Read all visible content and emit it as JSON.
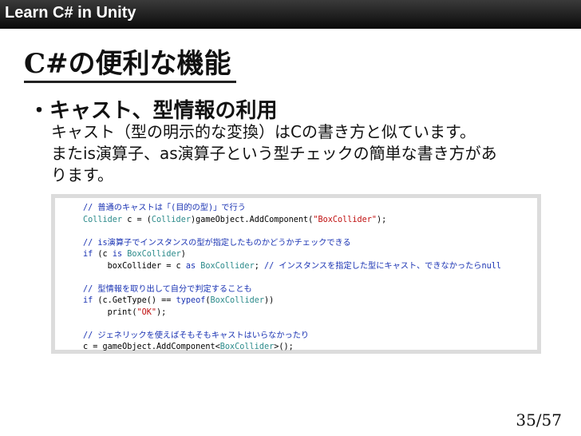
{
  "header": {
    "title": "Learn C# in Unity"
  },
  "slide": {
    "title": "C#の便利な機能",
    "bullet": "・キャスト、型情報の利用",
    "body_lines": [
      "キャスト（型の明示的な変換）はCの書き方と似ています。",
      "またis演算子、as演算子という型チェックの簡単な書き方があ",
      "ります。"
    ]
  },
  "code_lines": [
    [
      [
        "comment",
        "// 普通のキャストは「(目的の型)」で行う"
      ]
    ],
    [
      [
        "type",
        "Collider"
      ],
      [
        "plain",
        " c = ("
      ],
      [
        "type",
        "Collider"
      ],
      [
        "plain",
        ")gameObject.AddComponent("
      ],
      [
        "str",
        "\"BoxCollider\""
      ],
      [
        "plain",
        ");"
      ]
    ],
    [],
    [
      [
        "comment",
        "// is演算子でインスタンスの型が指定したものかどうかチェックできる"
      ]
    ],
    [
      [
        "kw",
        "if"
      ],
      [
        "plain",
        " (c "
      ],
      [
        "kw",
        "is"
      ],
      [
        "plain",
        " "
      ],
      [
        "type",
        "BoxCollider"
      ],
      [
        "plain",
        ")"
      ]
    ],
    [
      [
        "plain",
        "     boxCollider = c "
      ],
      [
        "kw",
        "as"
      ],
      [
        "plain",
        " "
      ],
      [
        "type",
        "BoxCollider"
      ],
      [
        "plain",
        "; "
      ],
      [
        "comment",
        "// インスタンスを指定した型にキャスト、できなかったらnull"
      ]
    ],
    [],
    [
      [
        "comment",
        "// 型情報を取り出して自分で判定することも"
      ]
    ],
    [
      [
        "kw",
        "if"
      ],
      [
        "plain",
        " (c.GetType() == "
      ],
      [
        "kw",
        "typeof"
      ],
      [
        "plain",
        "("
      ],
      [
        "type",
        "BoxCollider"
      ],
      [
        "plain",
        "))"
      ]
    ],
    [
      [
        "plain",
        "     print("
      ],
      [
        "str",
        "\"OK\""
      ],
      [
        "plain",
        ");"
      ]
    ],
    [],
    [
      [
        "comment",
        "// ジェネリックを使えばそもそもキャストはいらなかったり"
      ]
    ],
    [
      [
        "plain",
        "c = gameObject.AddComponent<"
      ],
      [
        "type",
        "BoxCollider"
      ],
      [
        "plain",
        ">();"
      ]
    ]
  ],
  "footer": {
    "page_number": "35/57"
  }
}
